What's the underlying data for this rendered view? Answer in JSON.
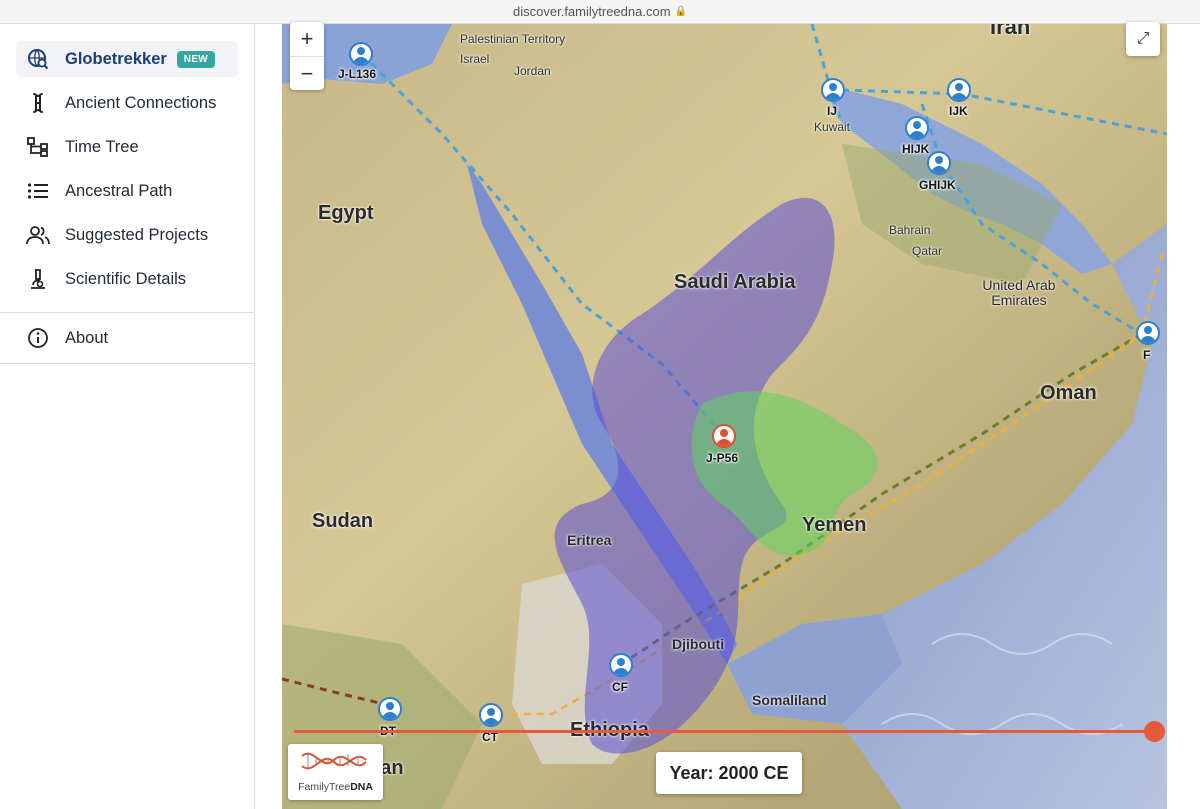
{
  "browser": {
    "url": "discover.familytreedna.com",
    "lock_icon": "lock-icon"
  },
  "sidebar": {
    "items": [
      {
        "label": "Globetrekker",
        "icon": "globe-search-icon",
        "badge": "NEW",
        "active": true
      },
      {
        "label": "Ancient Connections",
        "icon": "bone-icon"
      },
      {
        "label": "Time Tree",
        "icon": "tree-diagram-icon"
      },
      {
        "label": "Ancestral Path",
        "icon": "list-icon"
      },
      {
        "label": "Suggested Projects",
        "icon": "people-icon"
      },
      {
        "label": "Scientific Details",
        "icon": "microscope-icon"
      },
      {
        "label": "About",
        "icon": "info-icon"
      }
    ]
  },
  "map": {
    "zoom_in": "+",
    "zoom_out": "−",
    "fullscreen": "⤢",
    "countries": [
      "Egypt",
      "Saudi Arabia",
      "Sudan",
      "Eritrea",
      "Yemen",
      "Oman",
      "Ethiopia",
      "Djibouti",
      "Somaliland",
      "dan"
    ],
    "places": [
      "Palestinian Territory",
      "Israel",
      "Jordan",
      "Kuwait",
      "Bahrain",
      "Qatar",
      "United Arab Emirates",
      "Iran"
    ],
    "markers": [
      "J-L136",
      "IJ",
      "IJK",
      "HIJK",
      "GHIJK",
      "F",
      "J-P56",
      "CF",
      "DT",
      "CT"
    ],
    "colors": {
      "purple_region": "#5b4fd6",
      "green_region": "#5fd45f",
      "blue_path": "#4aa3d8",
      "orange_path": "#f0b030",
      "olive_path": "#6b7d2a",
      "red_path": "#8a3a2a",
      "timeline": "#e55a3c"
    }
  },
  "timeline": {
    "year_label": "Year: 2000 CE",
    "position": 1.0
  },
  "logo": {
    "text_a": "FamilyTree",
    "text_b": "DNA"
  }
}
